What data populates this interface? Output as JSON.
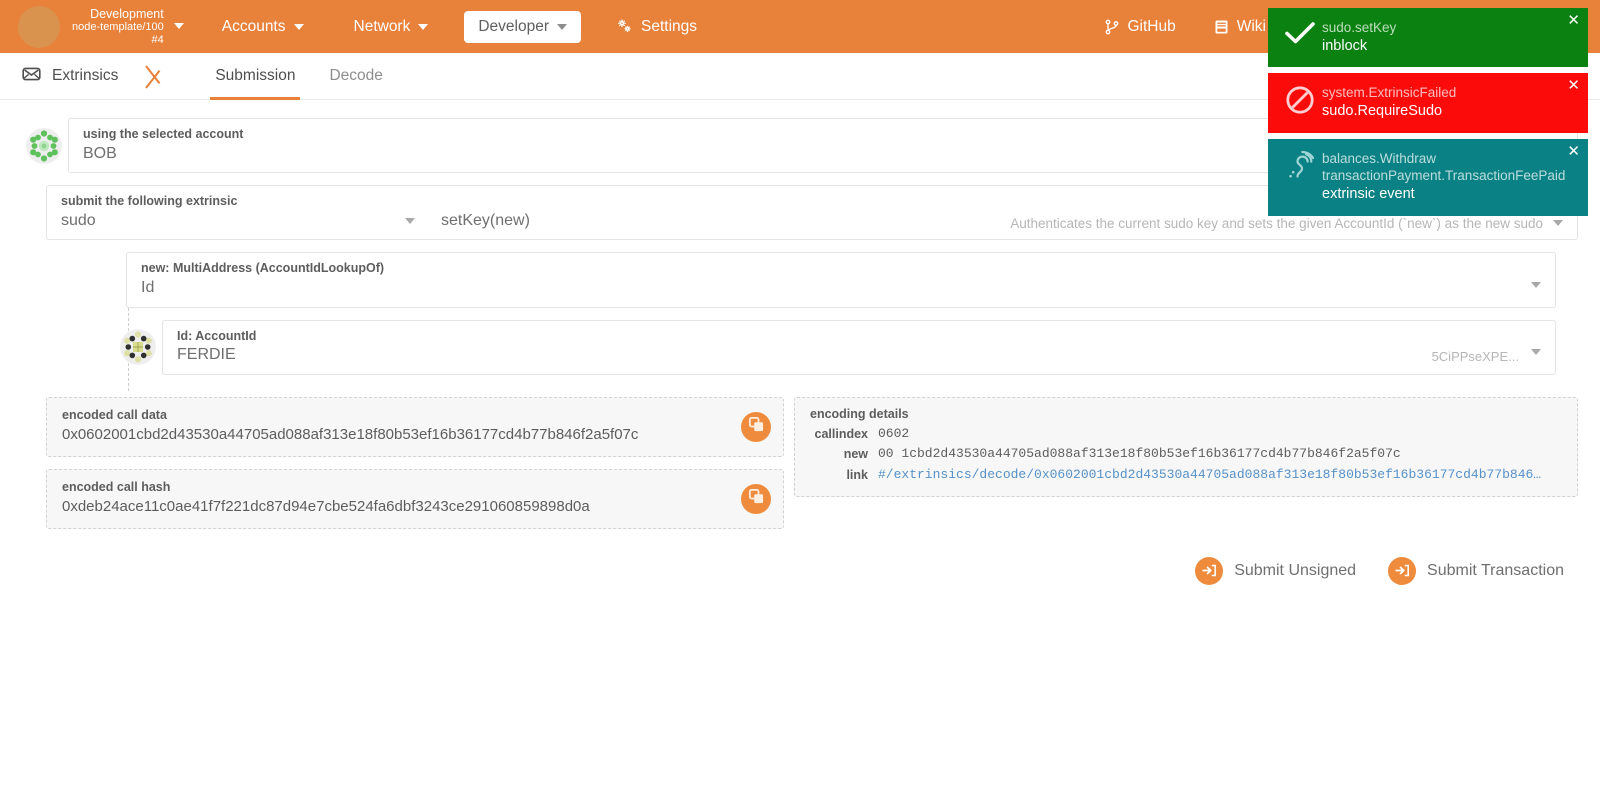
{
  "topbar": {
    "chain": {
      "name": "Development",
      "node": "node-template/100",
      "block": "#4"
    },
    "nav": [
      {
        "label": "Accounts",
        "icon": "chevron-down-icon"
      },
      {
        "label": "Network",
        "icon": "chevron-down-icon"
      },
      {
        "label": "Developer",
        "icon": "chevron-down-icon",
        "active": true
      },
      {
        "label": "Settings",
        "icon": "gears-icon"
      }
    ],
    "right": [
      {
        "label": "GitHub",
        "icon": "git-branch-icon"
      },
      {
        "label": "Wiki",
        "icon": "book-icon"
      }
    ]
  },
  "section": {
    "title": "Extrinsics",
    "icon": "mail-icon",
    "tabs": [
      {
        "label": "Submission",
        "active": true
      },
      {
        "label": "Decode",
        "active": false
      }
    ]
  },
  "account_row": {
    "label": "using the selected account",
    "value": "BOB"
  },
  "extrinsic_row": {
    "label": "submit the following extrinsic",
    "pallet": "sudo",
    "method": "setKey(new)",
    "docs": "Authenticates the current sudo key and sets the given AccountId (`new`) as the new sudo"
  },
  "multiaddress_row": {
    "label": "new: MultiAddress (AccountIdLookupOf)",
    "value": "Id"
  },
  "accountid_row": {
    "label": "Id: AccountId",
    "value": "FERDIE",
    "address_short": "5CiPPseXPE..."
  },
  "encoded": {
    "call_data_label": "encoded call data",
    "call_data_value": "0x0602001cbd2d43530a44705ad088af313e18f80b53ef16b36177cd4b77b846f2a5f07c",
    "call_hash_label": "encoded call hash",
    "call_hash_value": "0xdeb24ace11c0ae41f7f221dc87d94e7cbe524fa6dbf3243ce291060859898d0a",
    "copy_icon": "copy-icon"
  },
  "details": {
    "title": "encoding details",
    "rows": [
      {
        "key": "callindex",
        "value": "0602",
        "link": false
      },
      {
        "key": "new",
        "value": "00 1cbd2d43530a44705ad088af313e18f80b53ef16b36177cd4b77b846f2a5f07c",
        "link": false
      },
      {
        "key": "link",
        "value": "#/extrinsics/decode/0x0602001cbd2d43530a44705ad088af313e18f80b53ef16b36177cd4b77b846…",
        "link": true
      }
    ]
  },
  "submit": {
    "unsigned_label": "Submit Unsigned",
    "transaction_label": "Submit Transaction",
    "icon": "sign-in-icon"
  },
  "toasts": [
    {
      "kind": "green",
      "icon": "check-icon",
      "head": "sudo.setKey",
      "sub": "inblock",
      "close": "✕"
    },
    {
      "kind": "red",
      "icon": "ban-icon",
      "head": "system.ExtrinsicFailed",
      "sub": "sudo.RequireSudo",
      "close": "✕"
    },
    {
      "kind": "teal",
      "icon": "assistive-listening-icon",
      "head": "balances.Withdraw",
      "head2": "transactionPayment.TransactionFeePaid",
      "sub": "extrinsic event",
      "close": "✕"
    }
  ],
  "colors": {
    "brand_orange": "#e8813a",
    "button_orange": "#ee8b3d",
    "success_green": "#0a8110",
    "error_red": "#fc0b0b",
    "event_teal": "#0a8184",
    "link_blue": "#5591c9"
  }
}
